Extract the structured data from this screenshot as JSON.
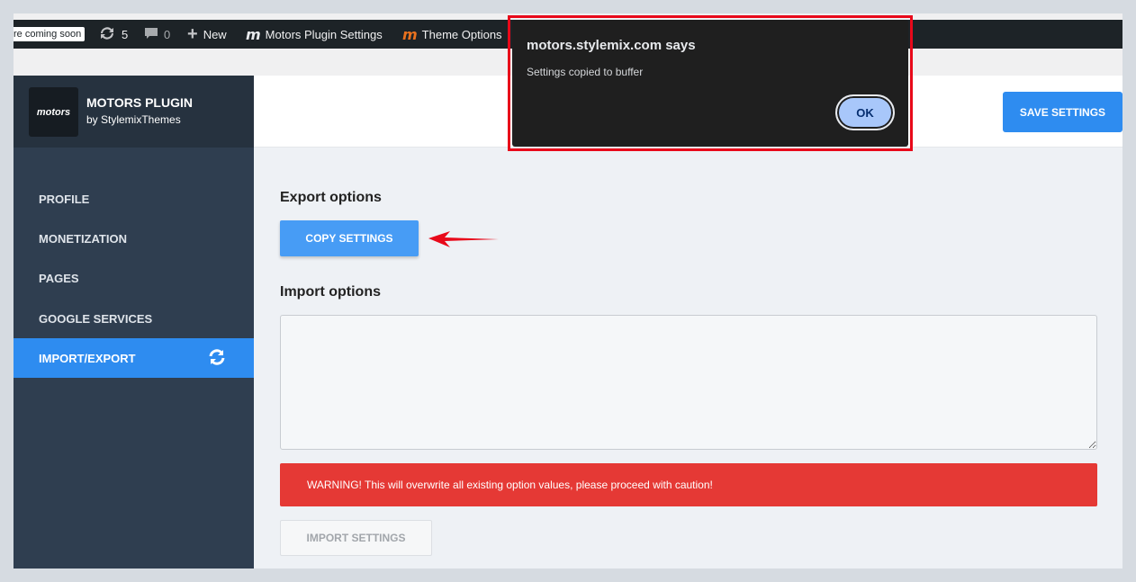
{
  "admin_bar": {
    "coming_soon": "re coming soon",
    "updates_count": "5",
    "comments_count": "0",
    "new_label": "New",
    "motors_plugin_settings": "Motors Plugin Settings",
    "theme_options": "Theme Options"
  },
  "sidebar": {
    "brand_logo_text": "motors",
    "brand_title": "MOTORS PLUGIN",
    "brand_subtitle": "by StylemixThemes",
    "items": [
      {
        "label": "PROFILE"
      },
      {
        "label": "MONETIZATION"
      },
      {
        "label": "PAGES"
      },
      {
        "label": "GOOGLE SERVICES"
      },
      {
        "label": "IMPORT/EXPORT",
        "active": true
      }
    ]
  },
  "header": {
    "save_label": "SAVE SETTINGS"
  },
  "main": {
    "export_title": "Export options",
    "copy_label": "COPY SETTINGS",
    "import_title": "Import options",
    "import_value": "",
    "warning": "WARNING! This will overwrite all existing option values, please proceed with caution!",
    "import_label": "IMPORT SETTINGS"
  },
  "dialog": {
    "title": "motors.stylemix.com says",
    "message": "Settings copied to buffer",
    "ok_label": "OK"
  },
  "colors": {
    "accent": "#2e8cf0",
    "sidebar": "#2f3e50",
    "warning": "#e53935",
    "highlight": "#e8091a"
  }
}
